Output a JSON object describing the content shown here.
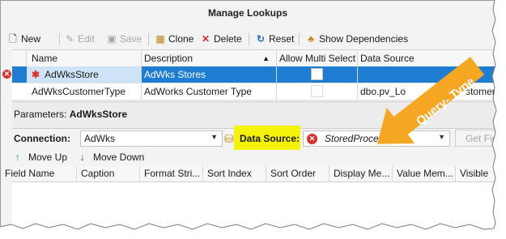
{
  "window": {
    "title": "Manage Lookups"
  },
  "toolbar": {
    "new_label": "New",
    "edit_label": "Edit",
    "save_label": "Save",
    "clone_label": "Clone",
    "delete_label": "Delete",
    "reset_label": "Reset",
    "show_dependencies_label": "Show Dependencies"
  },
  "lookups_grid": {
    "columns": [
      "Name",
      "Description",
      "Allow Multi Select",
      "Data Source"
    ],
    "rows": [
      {
        "name": "AdWksStore",
        "description": "AdWks Stores",
        "allow_multi_select": false,
        "data_source": "",
        "selected": true,
        "has_error": true
      },
      {
        "name": "AdWksCustomerType",
        "description": "AdWorks Customer Type",
        "allow_multi_select": false,
        "data_source": "dbo.pv_Lo",
        "selected": false,
        "has_error": false
      }
    ],
    "data_source_tail": "stomerType"
  },
  "parameters": {
    "label": "Parameters:",
    "value": "AdWksStore"
  },
  "connection": {
    "label": "Connection:",
    "value": "AdWks"
  },
  "data_source": {
    "label": "Data Source:",
    "value": "StoredProcedure"
  },
  "get_fields": {
    "label": "Get Fiel"
  },
  "move_up_label": "Move Up",
  "move_down_label": "Move Down",
  "params_grid": {
    "columns": [
      "Field Name",
      "Caption",
      "Format Stri...",
      "Sort Index",
      "Sort Order",
      "Display Me...",
      "Value Mem...",
      "Visible"
    ]
  },
  "annotation": {
    "text": "Query- Type",
    "color": "#f5a623"
  },
  "colors": {
    "selection": "#1e7dd0",
    "highlight": "#f5f20a",
    "error": "#d9302c"
  }
}
